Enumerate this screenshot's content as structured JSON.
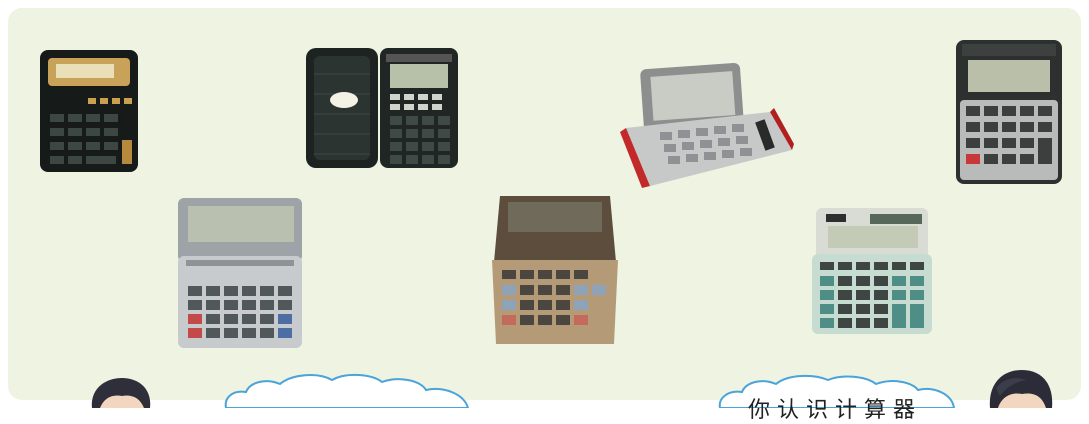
{
  "scene": {
    "background_color": "#eef3e2",
    "calculator_count": 8
  },
  "speech": {
    "right_bubble_text": "你 认 识 计 算 器"
  }
}
